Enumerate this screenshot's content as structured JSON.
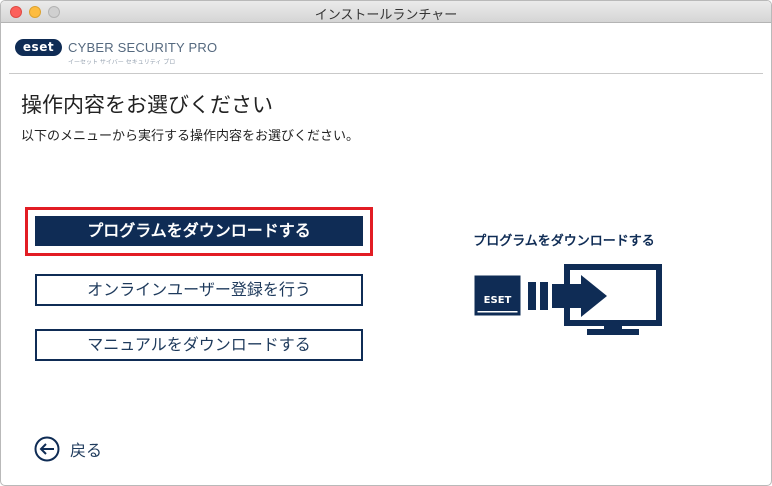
{
  "window": {
    "title": "インストールランチャー"
  },
  "brand": {
    "logo_text": "eset",
    "product_name": "CYBER SECURITY PRO",
    "product_sub": "イーセット サイバー セキュリティ プロ"
  },
  "page": {
    "title": "操作内容をお選びください",
    "description": "以下のメニューから実行する操作内容をお選びください。"
  },
  "menu": {
    "items": [
      {
        "label": "プログラムをダウンロードする",
        "selected": true
      },
      {
        "label": "オンラインユーザー登録を行う",
        "selected": false
      },
      {
        "label": "マニュアルをダウンロードする",
        "selected": false
      }
    ]
  },
  "preview": {
    "caption": "プログラムをダウンロードする",
    "box_label": "ESET"
  },
  "footer": {
    "back_label": "戻る"
  },
  "colors": {
    "primary": "#0f2c55",
    "highlight": "#e21d24"
  }
}
